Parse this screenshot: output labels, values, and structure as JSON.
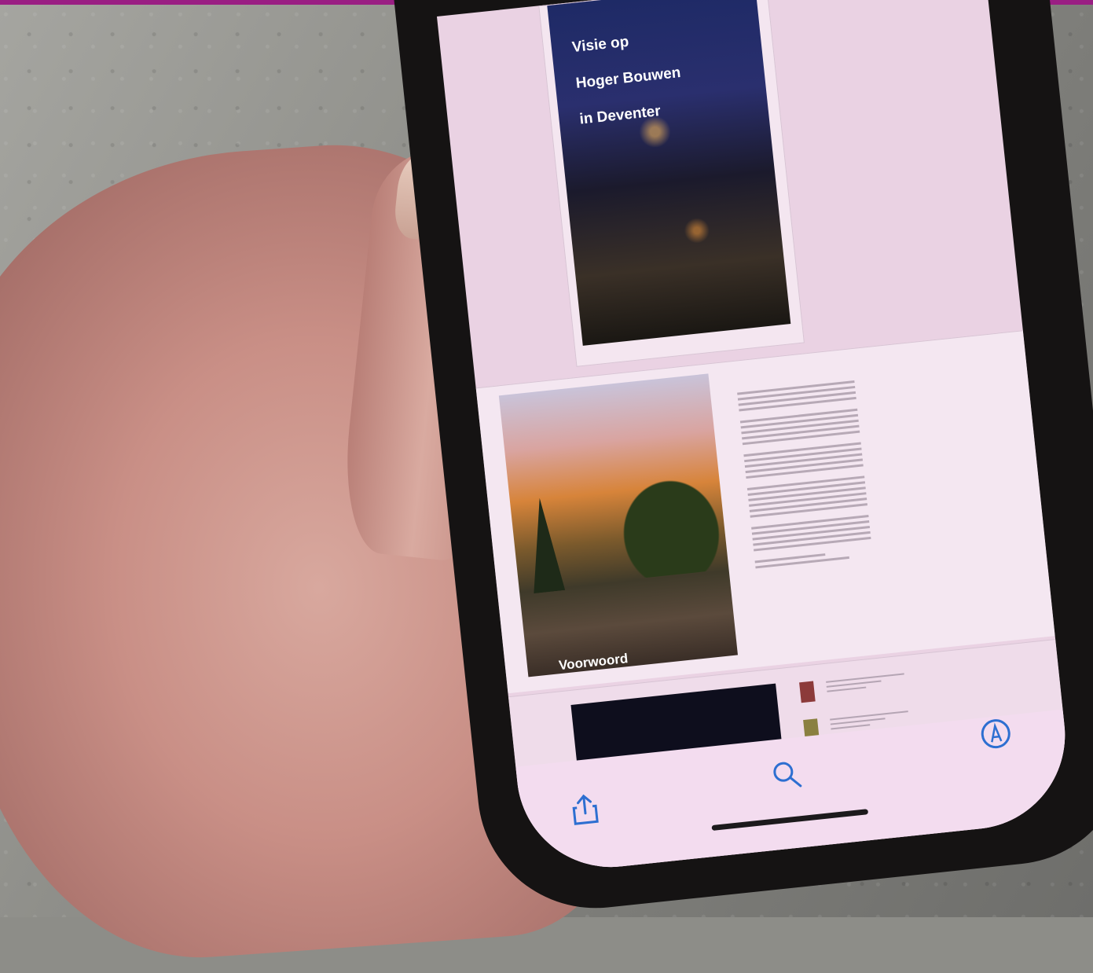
{
  "photo": {
    "scene": "hand holding smartphone showing PDF document over concrete floor",
    "accent_strip_color": "#9a1e83"
  },
  "pdf_viewer": {
    "cover": {
      "title_lines": [
        "Visie op",
        "Hoger Bouwen",
        "in Deventer"
      ]
    },
    "spread": {
      "image_label": "Voorwoord"
    },
    "toolbar": {
      "share_icon": "share-icon",
      "search_icon": "search-icon",
      "markup_icon": "markup-pen-icon"
    }
  }
}
